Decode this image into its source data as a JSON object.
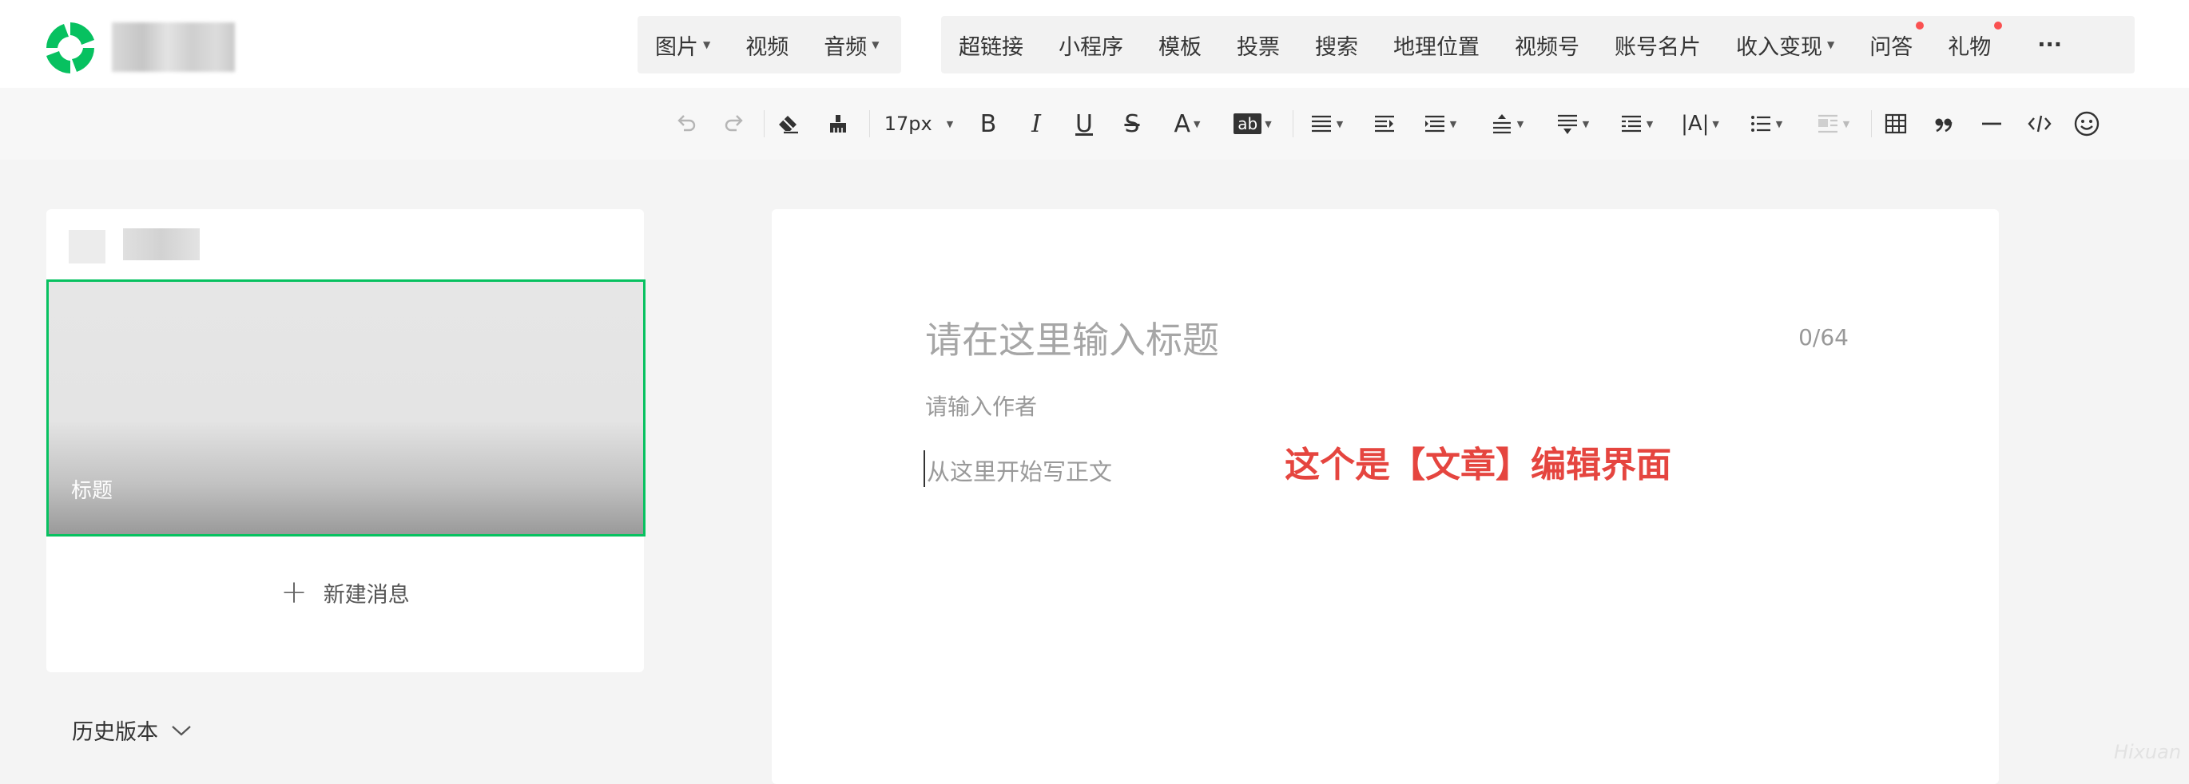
{
  "nav": {
    "media_menu": [
      {
        "label": "图片",
        "has_dropdown": true
      },
      {
        "label": "视频",
        "has_dropdown": false
      },
      {
        "label": "音频",
        "has_dropdown": true
      }
    ],
    "insert_menu": [
      {
        "label": "超链接",
        "has_dropdown": false,
        "badge": false
      },
      {
        "label": "小程序",
        "has_dropdown": false,
        "badge": false
      },
      {
        "label": "模板",
        "has_dropdown": false,
        "badge": false
      },
      {
        "label": "投票",
        "has_dropdown": false,
        "badge": false
      },
      {
        "label": "搜索",
        "has_dropdown": false,
        "badge": false
      },
      {
        "label": "地理位置",
        "has_dropdown": false,
        "badge": false
      },
      {
        "label": "视频号",
        "has_dropdown": false,
        "badge": false
      },
      {
        "label": "账号名片",
        "has_dropdown": false,
        "badge": false
      },
      {
        "label": "收入变现",
        "has_dropdown": true,
        "badge": false
      },
      {
        "label": "问答",
        "has_dropdown": false,
        "badge": true
      },
      {
        "label": "礼物",
        "has_dropdown": false,
        "badge": true
      }
    ],
    "more_label": "···"
  },
  "toolbar": {
    "font_size": "17px",
    "bold": "B",
    "italic": "I",
    "underline": "U",
    "strike": "S",
    "font_color": "A",
    "highlight": "ab",
    "letter_spacing": "|A|"
  },
  "sidebar": {
    "cover_title": "标题",
    "new_message": "新建消息",
    "new_message_icon": "+",
    "history": "历史版本"
  },
  "editor": {
    "title_placeholder": "请在这里输入标题",
    "title_counter": "0/64",
    "author_placeholder": "请输入作者",
    "body_placeholder": "从这里开始写正文",
    "annotation": "这个是【文章】编辑界面"
  },
  "watermark": "Hixuan",
  "colors": {
    "brand_green": "#07c160",
    "badge_red": "#fa5151",
    "annotation_red": "#e5453f"
  }
}
